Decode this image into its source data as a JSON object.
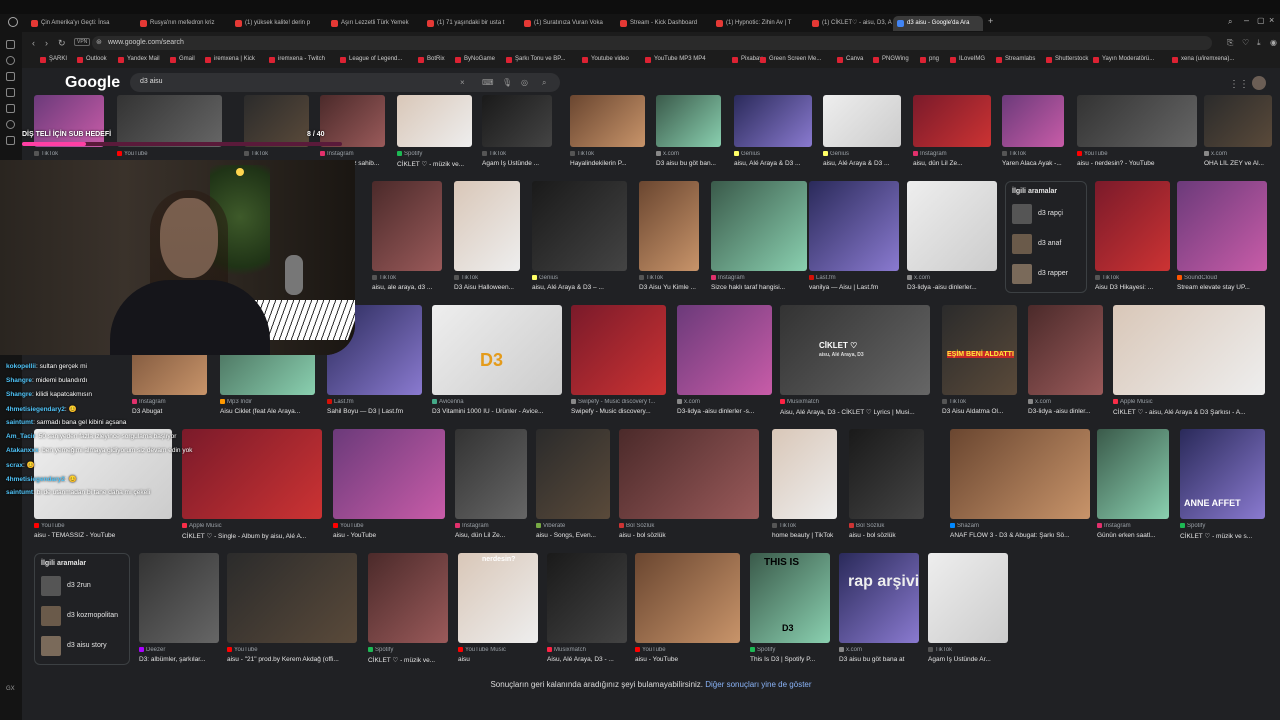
{
  "browser": {
    "tabs": [
      "Çin Amerika'yı Geçti: İnsa",
      "Rusya'nın mefedron kriz",
      "(1) yüksek kalite! derin p",
      "Aşırı Lezzetli Türk Yemek",
      "(1) 71 yaşındaki bir usta t",
      "(1) Suratınıza Vuran Voka",
      "Stream - Kick Dashboard",
      "(1) Hypnotic: Zihin Av | T",
      "(1) CİKLET♡ - aisu, D3, A",
      "d3 aisu - Google'da Ara"
    ],
    "url": "www.google.com/search",
    "vpn": "VPN",
    "bookmarks": [
      "ŞARKI",
      "Outlook",
      "Yandex Mail",
      "Gmail",
      "iremxena | Kick",
      "iremxena - Twitch",
      "League of Legend...",
      "BotRix",
      "ByNoGame",
      "Şarkı Tonu ve BP...",
      "Youtube video",
      "YouTube MP3 MP4",
      "Pixabay",
      "Green Screen Me...",
      "Canva",
      "PNGWing",
      "png",
      "ILoveIMG",
      "Streamlabs",
      "Shutterstock",
      "Yayın Moderatörü...",
      "xena (u/iremxena)..."
    ]
  },
  "google": {
    "logo": "Google",
    "query": "d3 aisu",
    "footer_text": "Sonuçların geri kalanında aradığınız şeyi bulamayabilirsiniz.",
    "footer_link": "Diğer sonuçları yine de göster"
  },
  "overlay": {
    "sub_goal": "DİŞ TELİ İÇİN SUB HEDEFİ",
    "sub_count": "8 / 40"
  },
  "chat": [
    {
      "user": "kokopellii",
      "msg": ": sultan gerçek mi"
    },
    {
      "user": "Shangre",
      "msg": ": midemi bulandırdı"
    },
    {
      "user": "Shangre",
      "msg": ": kilidi kapatcakmısın"
    },
    {
      "user": "4hmetisiegendary2",
      "msg": ": 😊"
    },
    {
      "user": "saintumt",
      "msg": ": sarmadı bana gel kibini açsana"
    },
    {
      "user": "Am_Tacir",
      "msg": ": 50 saniyeden fazla izleyince sorgulama başlıyor"
    },
    {
      "user": "Atakanxxx",
      "msg": ": ben yemeğimi almaya gidiyorum siz devam edin yok"
    },
    {
      "user": "scrax",
      "msg": ": 😊"
    },
    {
      "user": "4hmetisiegendary2",
      "msg": ": 😊"
    },
    {
      "user": "saintumt",
      "msg": ": bi de utanmadan bi tane daha mı çekeli"
    }
  ],
  "row1": [
    {
      "src": "TikTok",
      "title": ""
    },
    {
      "src": "YouTube",
      "title": ""
    },
    {
      "src": "TikTok",
      "title": ""
    },
    {
      "src": "Instagram",
      "title": "aisu ablamız sahib..."
    },
    {
      "src": "Spotify",
      "title": "CİKLET ♡ - müzik ve..."
    },
    {
      "src": "TikTok",
      "title": "Agam İş Üstünde ..."
    },
    {
      "src": "TikTok",
      "title": "Hayalindekilerin P..."
    },
    {
      "src": "x.com",
      "title": "D3 aisu bu göt ban..."
    },
    {
      "src": "Genius",
      "title": "aisu, Alé Araya & D3 ..."
    },
    {
      "src": "Genius",
      "title": "aisu, Alé Araya & D3 ..."
    },
    {
      "src": "Instagram",
      "title": "aisu, dün Lil Ze..."
    },
    {
      "src": "TikTok",
      "title": "Yaren Alaca Ayak -..."
    },
    {
      "src": "YouTube",
      "title": "aisu - nerdesin? - YouTube"
    },
    {
      "src": "x.com",
      "title": "OHA LİL ZEY ve Al..."
    }
  ],
  "row2": [
    {
      "src": "TikTok",
      "title": "aisu, ale araya, d3 ..."
    },
    {
      "src": "TikTok",
      "title": "D3 Aisu Halloween..."
    },
    {
      "src": "Genius",
      "title": "aisu, Alé Araya & D3 – ..."
    },
    {
      "src": "TikTok",
      "title": "D3 Aisu Yu Kimle ..."
    },
    {
      "src": "Instagram",
      "title": "Sizce haklı taraf hangisi..."
    },
    {
      "src": "Last.fm",
      "title": "vanilya — Aisu | Last.fm"
    },
    {
      "src": "x.com",
      "title": "D3-lidya -aisu dinlerler..."
    },
    {
      "src": "TikTok",
      "title": "Aisu D3 Hikayesi: ..."
    },
    {
      "src": "SoundCloud",
      "title": "Stream elevate stay UP..."
    }
  ],
  "related1": {
    "title": "İlgili aramalar",
    "items": [
      "d3 rapçi",
      "d3 anaf",
      "d3 rapper"
    ]
  },
  "row3": [
    {
      "src": "Instagram",
      "title": "D3 Abugat"
    },
    {
      "src": "Mp3 İndir",
      "title": "Aisu Ciklet (feat Ale Araya..."
    },
    {
      "src": "Last.fm",
      "title": "Sahil Boyu — D3 | Last.fm"
    },
    {
      "src": "Avicenna",
      "title": "D3 Vitamini 1000 IU - Ürünler - Avice..."
    },
    {
      "src": "Swipefy - Music discovery f...",
      "title": "Swipefy - Music discovery..."
    },
    {
      "src": "x.com",
      "title": "D3-lidya -aisu dinlerler -s..."
    },
    {
      "src": "Musixmatch",
      "title": "Aisu, Alé Araya, D3 - CİKLET ♡ Lyrics | Musi..."
    },
    {
      "src": "TikTok",
      "title": "D3 Aisu Aldatma Ol..."
    },
    {
      "src": "x.com",
      "title": "D3-lidya -aisu dinler..."
    },
    {
      "src": "Apple Music",
      "title": "CİKLET ♡ - aisu, Alé Araya & D3 Şarkısı - A..."
    }
  ],
  "row4": [
    {
      "src": "YouTube",
      "title": "aisu - TEMASSIZ - YouTube"
    },
    {
      "src": "Apple Music",
      "title": "CİKLET ♡ - Single - Album by aisu, Alé A..."
    },
    {
      "src": "YouTube",
      "title": "aisu - YouTube"
    },
    {
      "src": "Instagram",
      "title": "Aisu, dün Lil Ze..."
    },
    {
      "src": "Viberate",
      "title": "aisu - Songs, Even..."
    },
    {
      "src": "Bol Sözlük",
      "title": "aisu - bol sözlük"
    },
    {
      "src": "TikTok",
      "title": "home beauty | TikTok"
    },
    {
      "src": "Bol Sözlük",
      "title": "aisu - bol sözlük"
    },
    {
      "src": "Shazam",
      "title": "ANAF FLOW 3 - D3 & Abugat: Şarkı Sö..."
    },
    {
      "src": "Instagram",
      "title": "Günün erken saatl..."
    },
    {
      "src": "Spotify",
      "title": "CİKLET ♡ - müzik ve s..."
    }
  ],
  "related2": {
    "title": "İlgili aramalar",
    "items": [
      "d3 2run",
      "d3 kozmopolitan",
      "d3 aisu story"
    ]
  },
  "row5": [
    {
      "src": "Deezer",
      "title": "D3: albümler, şarkılar..."
    },
    {
      "src": "YouTube",
      "title": "aisu - \"21\" prod.by Kerem Akdağ (offi..."
    },
    {
      "src": "Spotify",
      "title": "CİKLET ♡ - müzik ve..."
    },
    {
      "src": "YouTube Music",
      "title": "aisu"
    },
    {
      "src": "Musixmatch",
      "title": "Aisu, Alé Araya, D3 - ..."
    },
    {
      "src": "YouTube",
      "title": "aisu - YouTube"
    },
    {
      "src": "Spotify",
      "title": "This Is D3 | Spotify P..."
    },
    {
      "src": "x.com",
      "title": "D3 aisu bu göt bana at"
    },
    {
      "src": "TikTok",
      "title": "Agam İş Üstünde Ar..."
    }
  ],
  "image_text": {
    "d3_vitamin": "D3",
    "this_is": "THIS IS",
    "this_is_d3": "D3",
    "rap_arsivi": "rap arşivi",
    "ciklet": "CİKLET ♡",
    "ciklet_sub": "aisu, Alé Araya, D3",
    "aldatma": "EŞİM BENİ ALDATTI",
    "anne": "ANNE AFFET",
    "nerdesin": "nerdesin?"
  },
  "misc": {
    "bottom_left": "GX"
  },
  "colors": {
    "accent": "#8ab4f8",
    "bg": "#202124",
    "tiktok": "#111111",
    "youtube": "#ff0000",
    "spotify": "#1db954",
    "instagram": "#e1306c",
    "x": "#000000",
    "genius": "#ffff64"
  }
}
